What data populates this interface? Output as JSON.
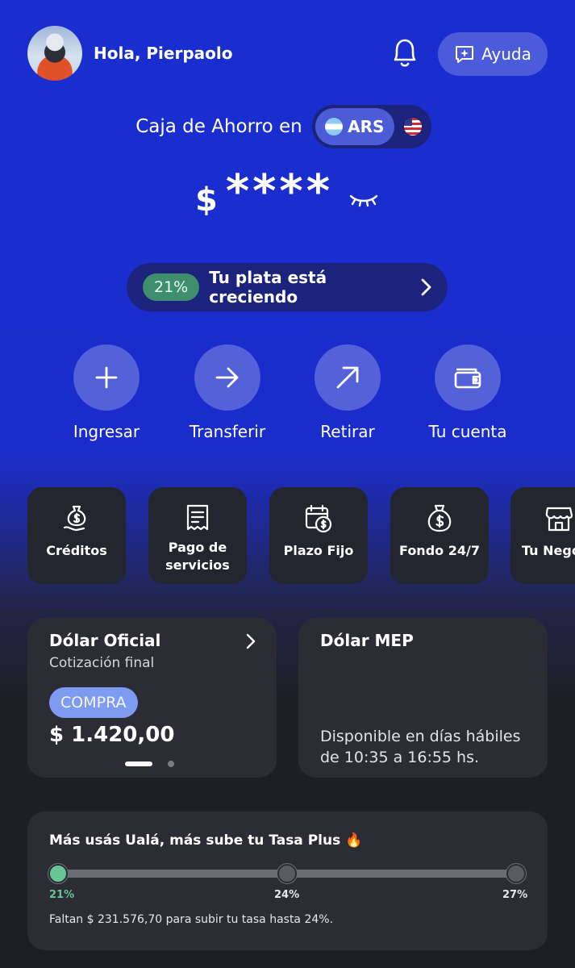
{
  "header": {
    "greeting": "Hola, Pierpaolo",
    "help_label": "Ayuda"
  },
  "account": {
    "label": "Caja de Ahorro en",
    "selected_currency": "ARS",
    "balance_symbol": "$",
    "balance_masked": "****"
  },
  "growth_banner": {
    "rate": "21%",
    "text": "Tu plata está creciendo"
  },
  "actions": [
    {
      "label": "Ingresar"
    },
    {
      "label": "Transferir"
    },
    {
      "label": "Retirar"
    },
    {
      "label": "Tu cuenta"
    }
  ],
  "shortcuts": [
    {
      "label": "Créditos"
    },
    {
      "label": "Pago de\nservicios"
    },
    {
      "label": "Plazo Fijo"
    },
    {
      "label": "Fondo 24/7"
    },
    {
      "label": "Tu Negocio"
    }
  ],
  "dolar_oficial": {
    "title": "Dólar Oficial",
    "subtitle": "Cotización final",
    "badge": "COMPRA",
    "price": "$ 1.420,00"
  },
  "dolar_mep": {
    "title": "Dólar MEP",
    "availability": "Disponible en días hábiles de 10:35 a 16:55 hs."
  },
  "tasa_plus": {
    "title": "Más usás Ualá, más sube tu Tasa Plus 🔥",
    "levels": [
      "21%",
      "24%",
      "27%"
    ],
    "current_level": "21%",
    "footer": "Faltan $ 231.576,70 para subir tu tasa hasta 24%."
  },
  "colors": {
    "brand_blue": "#1a2ed0",
    "accent_green": "#66c795",
    "card_bg": "#2b2c34"
  }
}
